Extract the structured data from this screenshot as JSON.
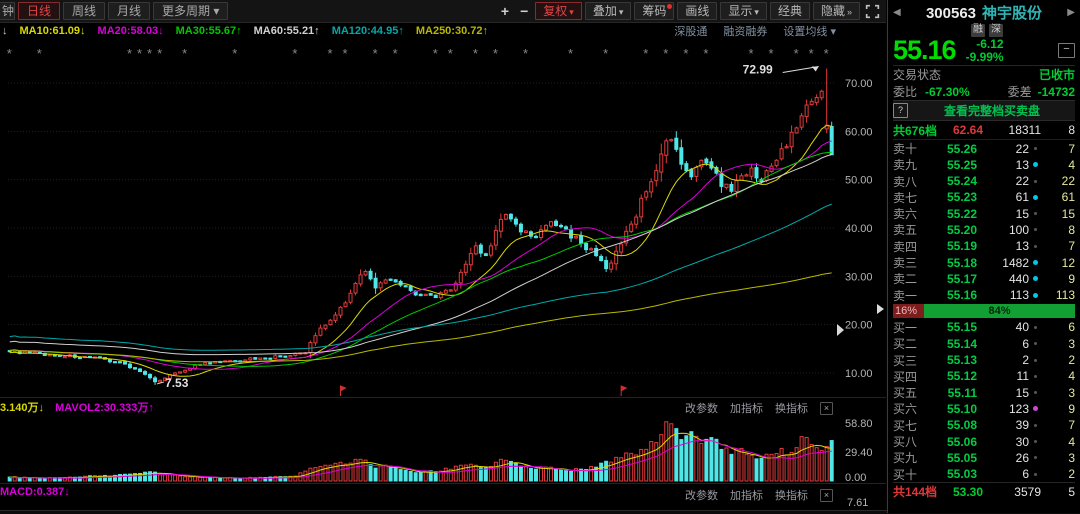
{
  "toolbar": {
    "partial_tab": "钟",
    "tabs": [
      {
        "label": "日线",
        "active": true
      },
      {
        "label": "周线",
        "active": false
      },
      {
        "label": "月线",
        "active": false
      },
      {
        "label": "更多周期 ▾",
        "active": false
      }
    ],
    "zoom_in": "+",
    "zoom_out": "−",
    "buttons": [
      {
        "label": "复权",
        "caret": "▾",
        "accent": true,
        "dot": false
      },
      {
        "label": "叠加",
        "caret": "▾",
        "accent": false,
        "dot": false
      },
      {
        "label": "筹码",
        "caret": "",
        "accent": false,
        "dot": true
      },
      {
        "label": "画线",
        "caret": "",
        "accent": false,
        "dot": false
      },
      {
        "label": "显示",
        "caret": "▾",
        "accent": false,
        "dot": false
      },
      {
        "label": "经典",
        "caret": "",
        "accent": false,
        "dot": false
      },
      {
        "label": "隐藏",
        "caret": "»",
        "accent": false,
        "dot": false
      }
    ]
  },
  "ma_bar": {
    "lead_arrow": "↓",
    "items": [
      {
        "label": "MA10:61.09",
        "arrow": "↓",
        "color": "#d9d900"
      },
      {
        "label": "MA20:58.03",
        "arrow": "↓",
        "color": "#d900d9"
      },
      {
        "label": "MA30:55.67",
        "arrow": "↑",
        "color": "#00c800"
      },
      {
        "label": "MA60:55.21",
        "arrow": "↑",
        "color": "#d0d0d0"
      },
      {
        "label": "MA120:44.95",
        "arrow": "↑",
        "color": "#00a8a8"
      },
      {
        "label": "MA250:30.72",
        "arrow": "↑",
        "color": "#b8b800"
      }
    ],
    "links": [
      "深股通",
      "融资融券",
      "设置均线 ▾"
    ]
  },
  "chart_data": {
    "type": "candlestick",
    "title": "300563 神宇股份 日线",
    "price_axis_ticks": [
      "70.00",
      "60.00",
      "50.00",
      "40.00",
      "30.00",
      "20.00",
      "10.00"
    ],
    "price_axis_values": [
      70,
      60,
      50,
      40,
      30,
      20,
      10
    ],
    "ylim": [
      5,
      75
    ],
    "n_days": 165,
    "prev_close": 61.28,
    "annotation_high": {
      "text": "72.99",
      "value": 72.99,
      "day": 163
    },
    "annotation_low": {
      "text": "7.53",
      "value": 7.53,
      "day": 29
    },
    "wick_day": {
      "day": 163,
      "open": 60.5,
      "close": 61.28,
      "high": 72.99,
      "low": 59.6
    },
    "last_day": {
      "day": 164,
      "open": 61.0,
      "close": 55.16,
      "high": 62.0,
      "low": 55.16
    },
    "close_anchors": [
      [
        0,
        14.5
      ],
      [
        8,
        13.8
      ],
      [
        16,
        13.2
      ],
      [
        22,
        12.3
      ],
      [
        26,
        10.3
      ],
      [
        29,
        8.2
      ],
      [
        33,
        10.0
      ],
      [
        38,
        11.8
      ],
      [
        44,
        12.6
      ],
      [
        50,
        13.1
      ],
      [
        56,
        13.6
      ],
      [
        59,
        14.2
      ],
      [
        60,
        16.3
      ],
      [
        62,
        19.3
      ],
      [
        65,
        22.0
      ],
      [
        68,
        26.5
      ],
      [
        70,
        30.3
      ],
      [
        71,
        31.0
      ],
      [
        73,
        27.6
      ],
      [
        76,
        29.3
      ],
      [
        79,
        28.0
      ],
      [
        82,
        26.0
      ],
      [
        85,
        25.6
      ],
      [
        88,
        27.2
      ],
      [
        91,
        32.5
      ],
      [
        93,
        36.3
      ],
      [
        95,
        34.3
      ],
      [
        97,
        39.5
      ],
      [
        99,
        42.8
      ],
      [
        102,
        39.2
      ],
      [
        105,
        38.0
      ],
      [
        108,
        41.3
      ],
      [
        111,
        39.8
      ],
      [
        114,
        36.8
      ],
      [
        117,
        34.3
      ],
      [
        119,
        31.6
      ],
      [
        121,
        35.2
      ],
      [
        124,
        40.8
      ],
      [
        127,
        47.5
      ],
      [
        130,
        55.3
      ],
      [
        132,
        58.3
      ],
      [
        134,
        53.2
      ],
      [
        136,
        50.6
      ],
      [
        138,
        54.0
      ],
      [
        140,
        52.4
      ],
      [
        142,
        48.6
      ],
      [
        144,
        47.6
      ],
      [
        146,
        50.8
      ],
      [
        148,
        52.4
      ],
      [
        150,
        49.6
      ],
      [
        152,
        52.8
      ],
      [
        154,
        56.4
      ],
      [
        156,
        59.8
      ],
      [
        158,
        63.2
      ],
      [
        160,
        66.2
      ],
      [
        161,
        67.0
      ],
      [
        162,
        68.3
      ],
      [
        163,
        61.28
      ],
      [
        164,
        55.16
      ]
    ],
    "ma_lines": [
      {
        "name": "MA10",
        "window": 10,
        "end_value": 61.09,
        "color": "#d9d900"
      },
      {
        "name": "MA20",
        "window": 20,
        "end_value": 58.03,
        "color": "#d900d9"
      },
      {
        "name": "MA30",
        "window": 30,
        "end_value": 55.67,
        "color": "#00c800"
      },
      {
        "name": "MA60",
        "window": 60,
        "end_value": 55.21,
        "color": "#d0d0d0"
      },
      {
        "name": "MA120",
        "window": 120,
        "end_value": 44.95,
        "color": "#00a8a8"
      },
      {
        "name": "MA250",
        "window": 250,
        "end_value": 30.72,
        "color": "#b8b800"
      }
    ],
    "colors": {
      "up": "#e23b3b",
      "down": "#4ee6e6",
      "grid": "#1f1f1f",
      "axis_text": "#b4b4b4",
      "annotation": "#e0e0e0",
      "event_marker": "#8a8a8a",
      "flag_marker": "#d02f2f"
    },
    "event_marker_days": [
      0,
      6,
      24,
      26,
      28,
      30,
      35,
      45,
      57,
      64,
      67,
      73,
      77,
      85,
      88,
      93,
      97,
      103,
      112,
      119,
      127,
      131,
      135,
      139,
      148,
      152,
      157,
      160,
      163
    ],
    "flag_marker_days": [
      66,
      122
    ],
    "volume": {
      "ylim": [
        0,
        58.8
      ],
      "axis_ticks": [
        "58.80",
        "29.40",
        "0.00"
      ],
      "unit": "万",
      "anchors": [
        [
          0,
          4
        ],
        [
          6,
          3
        ],
        [
          12,
          4
        ],
        [
          18,
          5
        ],
        [
          24,
          7
        ],
        [
          29,
          9
        ],
        [
          34,
          5
        ],
        [
          40,
          3.5
        ],
        [
          46,
          3
        ],
        [
          52,
          4
        ],
        [
          57,
          5
        ],
        [
          60,
          13
        ],
        [
          63,
          16
        ],
        [
          66,
          19
        ],
        [
          70,
          22
        ],
        [
          73,
          13
        ],
        [
          76,
          15
        ],
        [
          79,
          11
        ],
        [
          82,
          9
        ],
        [
          86,
          10
        ],
        [
          89,
          15
        ],
        [
          92,
          17
        ],
        [
          95,
          14
        ],
        [
          97,
          19
        ],
        [
          99,
          21
        ],
        [
          102,
          15
        ],
        [
          105,
          12
        ],
        [
          108,
          14
        ],
        [
          111,
          11
        ],
        [
          114,
          12
        ],
        [
          117,
          14
        ],
        [
          119,
          20
        ],
        [
          121,
          24
        ],
        [
          124,
          28
        ],
        [
          126,
          32
        ],
        [
          128,
          40
        ],
        [
          130,
          47
        ],
        [
          132,
          58
        ],
        [
          134,
          42
        ],
        [
          136,
          50
        ],
        [
          138,
          38
        ],
        [
          140,
          44
        ],
        [
          142,
          32
        ],
        [
          144,
          27
        ],
        [
          146,
          33
        ],
        [
          148,
          26
        ],
        [
          150,
          23
        ],
        [
          152,
          27
        ],
        [
          154,
          33
        ],
        [
          156,
          29
        ],
        [
          158,
          45
        ],
        [
          160,
          37
        ],
        [
          162,
          31
        ],
        [
          163,
          35
        ],
        [
          164,
          41
        ]
      ],
      "mavol_lines": [
        {
          "name": "MAVOL1",
          "window": 5,
          "end_value": 33.14,
          "color": "#d9d900"
        },
        {
          "name": "MAVOL2",
          "window": 10,
          "end_value": 30.333,
          "color": "#d900d9"
        }
      ]
    }
  },
  "volume_pane": {
    "left_label": "3.140万",
    "left_arrow": "↓",
    "mavol2_label": "MAVOL2:30.333万",
    "mavol2_arrow": "↑",
    "links": [
      "改参数",
      "加指标",
      "换指标"
    ],
    "close_icon": "×"
  },
  "macd_pane": {
    "label": "MACD:0.387",
    "arrow": "↓",
    "links": [
      "改参数",
      "加指标",
      "换指标"
    ],
    "close_icon": "×",
    "axis_label": "7.61"
  },
  "quote_panel": {
    "prev_icon": "◀",
    "next_icon": "▶",
    "code": "300563",
    "name": "神宇股份",
    "badges": [
      "融",
      "深"
    ],
    "price": "55.16",
    "change": "-6.12",
    "change_pct": "-9.99%",
    "minimize_icon": "−",
    "status_label": "交易状态",
    "status_value": "已收市",
    "weibi_label": "委比",
    "weibi_value": "-67.30%",
    "weicha_label": "委差",
    "weicha_value": "-14732",
    "help_icon": "?",
    "view_full_book": "查看完整档买卖盘",
    "sell_summary": {
      "label": "共676档",
      "price": "62.64",
      "vol": "18311",
      "count": "8"
    },
    "sell_rows": [
      {
        "label": "卖十",
        "price": "55.26",
        "vol": "22",
        "count": "7",
        "dot": "gray"
      },
      {
        "label": "卖九",
        "price": "55.25",
        "vol": "13",
        "count": "4",
        "dot": "cyan"
      },
      {
        "label": "卖八",
        "price": "55.24",
        "vol": "22",
        "count": "22",
        "dot": "gray"
      },
      {
        "label": "卖七",
        "price": "55.23",
        "vol": "61",
        "count": "61",
        "dot": "cyan"
      },
      {
        "label": "卖六",
        "price": "55.22",
        "vol": "15",
        "count": "15",
        "dot": "gray"
      },
      {
        "label": "卖五",
        "price": "55.20",
        "vol": "100",
        "count": "8",
        "dot": "gray"
      },
      {
        "label": "卖四",
        "price": "55.19",
        "vol": "13",
        "count": "7",
        "dot": "gray"
      },
      {
        "label": "卖三",
        "price": "55.18",
        "vol": "1482",
        "count": "12",
        "dot": "cyan"
      },
      {
        "label": "卖二",
        "price": "55.17",
        "vol": "440",
        "count": "9",
        "dot": "cyan"
      },
      {
        "label": "卖一",
        "price": "55.16",
        "vol": "113",
        "count": "113",
        "dot": "cyan"
      }
    ],
    "ratio_bar": {
      "left_label": "16%",
      "right_label": "84%",
      "left_pct": 16
    },
    "buy_rows": [
      {
        "label": "买一",
        "price": "55.15",
        "vol": "40",
        "count": "6",
        "dot": "gray"
      },
      {
        "label": "买二",
        "price": "55.14",
        "vol": "6",
        "count": "3",
        "dot": "gray"
      },
      {
        "label": "买三",
        "price": "55.13",
        "vol": "2",
        "count": "2",
        "dot": "gray"
      },
      {
        "label": "买四",
        "price": "55.12",
        "vol": "11",
        "count": "4",
        "dot": "gray"
      },
      {
        "label": "买五",
        "price": "55.11",
        "vol": "15",
        "count": "3",
        "dot": "gray"
      },
      {
        "label": "买六",
        "price": "55.10",
        "vol": "123",
        "count": "9",
        "dot": "magenta"
      },
      {
        "label": "买七",
        "price": "55.08",
        "vol": "39",
        "count": "7",
        "dot": "gray"
      },
      {
        "label": "买八",
        "price": "55.06",
        "vol": "30",
        "count": "4",
        "dot": "gray"
      },
      {
        "label": "买九",
        "price": "55.05",
        "vol": "26",
        "count": "3",
        "dot": "gray"
      },
      {
        "label": "买十",
        "price": "55.03",
        "vol": "6",
        "count": "2",
        "dot": "gray"
      }
    ],
    "buy_summary": {
      "label": "共144档",
      "price": "53.30",
      "vol": "3579",
      "count": "5"
    }
  }
}
